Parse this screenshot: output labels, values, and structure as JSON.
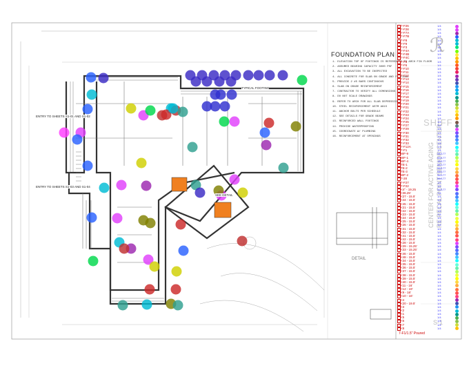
{
  "drawing": {
    "title": "FOUNDATION PLAN",
    "logo_text": "SHIFF",
    "project_line1": "CENTER FOR ACTIVE AGING",
    "project_line2": "RE PECAL POINT SENIOR CENTER",
    "sheet_number": "S-1",
    "detail_label": "DETAIL",
    "footer_label": "7-F1/1.5\" Poured"
  },
  "notes": [
    "1. ELEVATION TOP OF FOOTINGS IS REFERENCED TO ARCH FIN FLOOR",
    "2. ASSUMED BEARING CAPACITY 3000 PSF",
    "3. ALL EXCAVATION TO BE INSPECTED",
    "4. ALL CONCRETE FOR SLAB ON GRADE AND FOOTINGS",
    "5. PROVIDE 2 #5 BARS CONTINUOUS",
    "6. SLAB ON GRADE REINFORCEMENT",
    "7. CONTRACTOR TO VERIFY ALL DIMENSIONS",
    "8. DO NOT SCALE DRAWINGS",
    "9. REFER TO ARCH FOR ALL SLAB DEPRESSIONS",
    "10. STEEL REINFORCEMENT ASTM A615",
    "11. ANCHOR BOLTS PER SCHEDULE",
    "12. SEE DETAILS FOR GRADE BEAMS",
    "13. REINFORCED WALL FOOTINGS",
    "14. PROVIDE WATERPROOFING",
    "15. COORDINATE W/ PLUMBING",
    "16. REINFORCEMENT AT OPENINGS"
  ],
  "plan_labels": [
    "ENTRY TO SHEETS S1-01 AND S1-02",
    "ENTRY TO SHEETS S1-03 AND S1-04",
    "TYPICAL FOOTING",
    "SEE DETAIL"
  ],
  "panel_rows": [
    {
      "label": "7-F26",
      "num": "1/4",
      "color": "#e040fb"
    },
    {
      "label": "7-F28",
      "num": "1/4",
      "color": "#e040fb"
    },
    {
      "label": "7-F7A",
      "num": "1/4",
      "color": "#9c27b0"
    },
    {
      "label": "7-F7B",
      "num": "1/4",
      "color": "#2962ff"
    },
    {
      "label": "7-F8",
      "num": "1/4",
      "color": "#00bcd4"
    },
    {
      "label": "7-F9",
      "num": "1/4",
      "color": "#00bcd4"
    },
    {
      "label": "7-F3",
      "num": "1/4",
      "color": "#00e676"
    },
    {
      "label": "7-F4A",
      "num": "1/4",
      "color": "#76ff03"
    },
    {
      "label": "7-F4B",
      "num": "1/4",
      "color": "#ffeb3b"
    },
    {
      "label": "7-F4C",
      "num": "1/4",
      "color": "#ffc107"
    },
    {
      "label": "7-F5",
      "num": "1/4",
      "color": "#ff9800"
    },
    {
      "label": "7-F6",
      "num": "1/4",
      "color": "#ff5722"
    },
    {
      "label": "7-F10",
      "num": "1/4",
      "color": "#f44336"
    },
    {
      "label": "7-F11",
      "num": "1/4",
      "color": "#e91e63"
    },
    {
      "label": "7-F12",
      "num": "1/4",
      "color": "#9c27b0"
    },
    {
      "label": "7-F13",
      "num": "1/4",
      "color": "#673ab7"
    },
    {
      "label": "7-F14",
      "num": "1/4",
      "color": "#3f51b5"
    },
    {
      "label": "7-F15",
      "num": "1/4",
      "color": "#2196f3"
    },
    {
      "label": "7-F16",
      "num": "1/4",
      "color": "#03a9f4"
    },
    {
      "label": "7-F17",
      "num": "1/4",
      "color": "#00bcd4"
    },
    {
      "label": "7-F18",
      "num": "1/4",
      "color": "#009688"
    },
    {
      "label": "7-F19",
      "num": "1/4",
      "color": "#4caf50"
    },
    {
      "label": "7-F20",
      "num": "1/4",
      "color": "#8bc34a"
    },
    {
      "label": "7-F21",
      "num": "1/4",
      "color": "#cddc39"
    },
    {
      "label": "7-F22",
      "num": "1/4",
      "color": "#ffeb3b"
    },
    {
      "label": "7-F23",
      "num": "1/4",
      "color": "#ffc107"
    },
    {
      "label": "7-F24",
      "num": "1/4",
      "color": "#ff9800"
    },
    {
      "label": "7-F25",
      "num": "1/4",
      "color": "#795548"
    },
    {
      "label": "7-F27",
      "num": "1/4",
      "color": "#607d8b"
    },
    {
      "label": "7-F29",
      "num": "1/4",
      "color": "#e040fb"
    },
    {
      "label": "7-F30",
      "num": "1/4",
      "color": "#7c4dff"
    },
    {
      "label": "7-F31",
      "num": "1/4",
      "color": "#536dfe"
    },
    {
      "label": "7-F32",
      "num": "1/4",
      "color": "#448aff"
    },
    {
      "label": "7-F33",
      "num": "1/4",
      "color": "#40c4ff"
    },
    {
      "label": "7-F12A",
      "num": "1/4",
      "color": "#18ffff"
    },
    {
      "label": "7-F1",
      "num": "1/4",
      "color": "#64ffda"
    },
    {
      "label": "WF-9",
      "num": "56/177",
      "color": "#69f0ae"
    },
    {
      "label": "WF-1",
      "num": "56/177",
      "color": "#b2ff59"
    },
    {
      "label": "WF-4",
      "num": "18/177",
      "color": "#eeff41"
    },
    {
      "label": "TE-1",
      "num": "56/177",
      "color": "#ffff00"
    },
    {
      "label": "TE-2",
      "num": "56/177",
      "color": "#ffd740"
    },
    {
      "label": "TE-3",
      "num": "56/177",
      "color": "#ffab40"
    },
    {
      "label": "WF-2",
      "num": "56/177",
      "color": "#ff6e40"
    },
    {
      "label": "7-28",
      "num": "56/177",
      "color": "#ff5252"
    },
    {
      "label": "7-F27",
      "num": "1/4",
      "color": "#ff4081"
    },
    {
      "label": "7-F22",
      "num": "1/4",
      "color": "#e040fb"
    },
    {
      "label": "<4\" - 19.25",
      "num": "56/177",
      "color": "#7c4dff"
    },
    {
      "label": "<36.25'",
      "num": "1/4",
      "color": "#536dfe"
    },
    {
      "label": "<27 - 15.5'",
      "num": "1/4",
      "color": "#448aff"
    },
    {
      "label": "<44 - 15.5'",
      "num": "1/4",
      "color": "#40c4ff"
    },
    {
      "label": "<45 - 15.5'",
      "num": "1/4",
      "color": "#18ffff"
    },
    {
      "label": "<21 - 15.5'",
      "num": "1/4",
      "color": "#64ffda"
    },
    {
      "label": "<22 - 15.5'",
      "num": "1/4",
      "color": "#69f0ae"
    },
    {
      "label": "<23 - 15.5'",
      "num": "1/4",
      "color": "#b2ff59"
    },
    {
      "label": "<24 - 15.5'",
      "num": "1/4",
      "color": "#eeff41"
    },
    {
      "label": "<25 - 15.5'",
      "num": "1/4",
      "color": "#ffff00"
    },
    {
      "label": "<26 - 15.5'",
      "num": "1/4",
      "color": "#ffd740"
    },
    {
      "label": "<31 - 15.5'",
      "num": "1/4",
      "color": "#ffab40"
    },
    {
      "label": "<32 - 15.5'",
      "num": "1/4",
      "color": "#ff6e40"
    },
    {
      "label": "<41 - 15.5'",
      "num": "1/4",
      "color": "#ff5252"
    },
    {
      "label": "<42 - 15.5'",
      "num": "1/4",
      "color": "#ff4081"
    },
    {
      "label": "<28 - 15.5'",
      "num": "1/4",
      "color": "#e040fb"
    },
    {
      "label": "<29 - 15.25'",
      "num": "1/4",
      "color": "#7c4dff"
    },
    {
      "label": "<33 - 15.25'",
      "num": "1/4",
      "color": "#536dfe"
    },
    {
      "label": "<46 - 15.5'",
      "num": "1/4",
      "color": "#448aff"
    },
    {
      "label": "<48 - 15.5'",
      "num": "1/4",
      "color": "#40c4ff"
    },
    {
      "label": "<34 - 15.5'",
      "num": "1/4",
      "color": "#18ffff"
    },
    {
      "label": "<35 - 15.5'",
      "num": "1/4",
      "color": "#64ffda"
    },
    {
      "label": "<36 - 15.5'",
      "num": "1/4",
      "color": "#69f0ae"
    },
    {
      "label": "<37 - 15.5'",
      "num": "1/4",
      "color": "#b2ff59"
    },
    {
      "label": "<38 - 15.5'",
      "num": "1/4",
      "color": "#eeff41"
    },
    {
      "label": "<39 - 15.5'",
      "num": "1/4",
      "color": "#ffff00"
    },
    {
      "label": "<40 - 15.5'",
      "num": "1/4",
      "color": "#ffd740"
    },
    {
      "label": "<11 - 16'",
      "num": "1/4",
      "color": "#ffab40"
    },
    {
      "label": "<12 - 19'",
      "num": "1/4",
      "color": "#ff6e40"
    },
    {
      "label": "<9 - 16'",
      "num": "1/4",
      "color": "#ff5252"
    },
    {
      "label": "<10 - 16'",
      "num": "1/4",
      "color": "#ff4081"
    },
    {
      "label": "<4",
      "num": "1/4",
      "color": "#9c27b0"
    },
    {
      "label": "<20 - 19.5'",
      "num": "1/4",
      "color": "#3f51b5"
    },
    {
      "label": "<3",
      "num": "1/4",
      "color": "#2196f3"
    },
    {
      "label": "<2",
      "num": "1/4",
      "color": "#00bcd4"
    },
    {
      "label": "<1",
      "num": "1/4",
      "color": "#009688"
    },
    {
      "label": "<5",
      "num": "1/4",
      "color": "#4caf50"
    },
    {
      "label": "<6",
      "num": "1/4",
      "color": "#8bc34a"
    },
    {
      "label": "<7",
      "num": "1/4",
      "color": "#cddc39"
    },
    {
      "label": "<8",
      "num": "1/4",
      "color": "#ffc107"
    }
  ],
  "markers": [
    {
      "color": "#3b2bc4"
    },
    {
      "color": "#3b2bc4"
    },
    {
      "color": "#3b2bc4"
    },
    {
      "color": "#3b2bc4"
    },
    {
      "color": "#3b2bc4"
    },
    {
      "color": "#3b2bc4"
    },
    {
      "color": "#3b2bc4"
    },
    {
      "color": "#3b2bc4"
    },
    {
      "color": "#3b2bc4"
    },
    {
      "color": "#3b2bc4"
    },
    {
      "color": "#3b2bc4"
    },
    {
      "color": "#3b2bc4"
    },
    {
      "color": "#3b2bc4"
    },
    {
      "color": "#2f2fd0"
    },
    {
      "color": "#2f2fd0"
    },
    {
      "color": "#2f2fd0"
    },
    {
      "color": "#2f2fd0"
    },
    {
      "color": "#2f2fd0"
    },
    {
      "color": "#2f2fd0"
    },
    {
      "color": "#00bcd4"
    },
    {
      "color": "#ff3dff"
    },
    {
      "color": "#e040fb"
    },
    {
      "color": "#d0d000"
    },
    {
      "color": "#c03030"
    },
    {
      "color": "#3b2bc4"
    },
    {
      "color": "#00bcd4"
    },
    {
      "color": "#2962ff"
    },
    {
      "color": "#2962ff"
    },
    {
      "color": "#e040fb"
    },
    {
      "color": "#00d84c"
    },
    {
      "color": "#2962ff"
    },
    {
      "color": "#cc2a2a"
    },
    {
      "color": "#c03030"
    },
    {
      "color": "#00bcd4"
    },
    {
      "color": "#30a090"
    },
    {
      "color": "#30a090"
    },
    {
      "color": "#d0d000"
    },
    {
      "color": "#e040fb"
    },
    {
      "color": "#9c27b0"
    },
    {
      "color": "#2962ff"
    },
    {
      "color": "#00bcd4"
    },
    {
      "color": "#808000"
    },
    {
      "color": "#808000"
    },
    {
      "color": "#cc2a2a"
    },
    {
      "color": "#30a090"
    },
    {
      "color": "#e040fb"
    },
    {
      "color": "#e040fb"
    },
    {
      "color": "#3b2bc4"
    },
    {
      "color": "#c03030"
    },
    {
      "color": "#d0d000"
    },
    {
      "color": "#00d84c"
    },
    {
      "color": "#cc2a2a"
    },
    {
      "color": "#9c27b0"
    },
    {
      "color": "#808000"
    },
    {
      "color": "#2962ff"
    },
    {
      "color": "#30a090"
    },
    {
      "color": "#e040fb"
    },
    {
      "color": "#00bcd4"
    },
    {
      "color": "#d0d000"
    },
    {
      "color": "#cc2a2a"
    },
    {
      "color": "#808000"
    },
    {
      "color": "#00d84c"
    },
    {
      "color": "#2962ff"
    },
    {
      "color": "#e040fb"
    },
    {
      "color": "#9c27b0"
    },
    {
      "color": "#c03030"
    },
    {
      "color": "#30a090"
    },
    {
      "color": "#00bcd4"
    },
    {
      "color": "#d0d000"
    },
    {
      "color": "#2962ff"
    },
    {
      "color": "#e040fb"
    },
    {
      "color": "#808000"
    },
    {
      "color": "#cc2a2a"
    },
    {
      "color": "#30a090"
    },
    {
      "color": "#00d84c"
    }
  ]
}
